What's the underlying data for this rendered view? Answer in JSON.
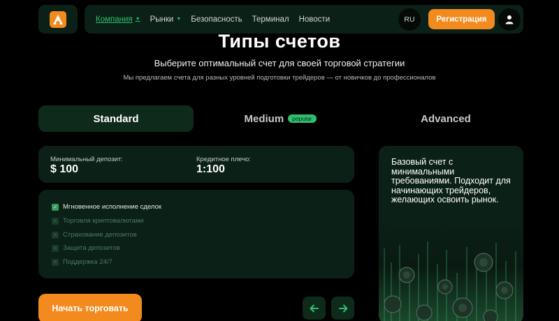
{
  "header": {
    "logo_icon": "brand-logo-a",
    "nav": [
      {
        "label": "Компания",
        "active": true,
        "has_dropdown": true
      },
      {
        "label": "Рынки",
        "active": false,
        "has_dropdown": true
      },
      {
        "label": "Безопасность",
        "active": false,
        "has_dropdown": false
      },
      {
        "label": "Терминал",
        "active": false,
        "has_dropdown": false
      },
      {
        "label": "Новости",
        "active": false,
        "has_dropdown": false
      }
    ],
    "language": "RU",
    "register_label": "Регистрация",
    "user_icon": "user-icon"
  },
  "hero": {
    "title": "Типы счетов",
    "subtitle": "Выберите оптимальный счет для своей торговой стратегии",
    "description": "Мы предлагаем счета для разных уровней подготовки трейдеров — от новичков до профессионалов"
  },
  "tabs": [
    {
      "label": "Standard",
      "active": true,
      "badge": ""
    },
    {
      "label": "Medium",
      "active": false,
      "badge": "popular"
    },
    {
      "label": "Advanced",
      "active": false,
      "badge": ""
    }
  ],
  "account": {
    "min_deposit_label": "Минимальный депозит:",
    "min_deposit_value": "$ 100",
    "leverage_label": "Кредитное плечо:",
    "leverage_value": "1:100",
    "features": [
      {
        "label": "Мгновенное исполнение сделок",
        "enabled": true
      },
      {
        "label": "Торговля криптовалютами",
        "enabled": false
      },
      {
        "label": "Страхование депозитов",
        "enabled": false
      },
      {
        "label": "Защита депозитов",
        "enabled": false
      },
      {
        "label": "Поддержка 24/7",
        "enabled": false
      }
    ],
    "info_text": "Базовый счет с минимальными требованиями. Подходит для начинающих трейдеров, желающих освоить рынок."
  },
  "actions": {
    "start_label": "Начать торговать",
    "prev_icon": "arrow-left-icon",
    "next_icon": "arrow-right-icon"
  },
  "colors": {
    "accent": "#f28a1e",
    "green": "#2fbf71",
    "panel": "#0b2016",
    "background": "#000000"
  }
}
